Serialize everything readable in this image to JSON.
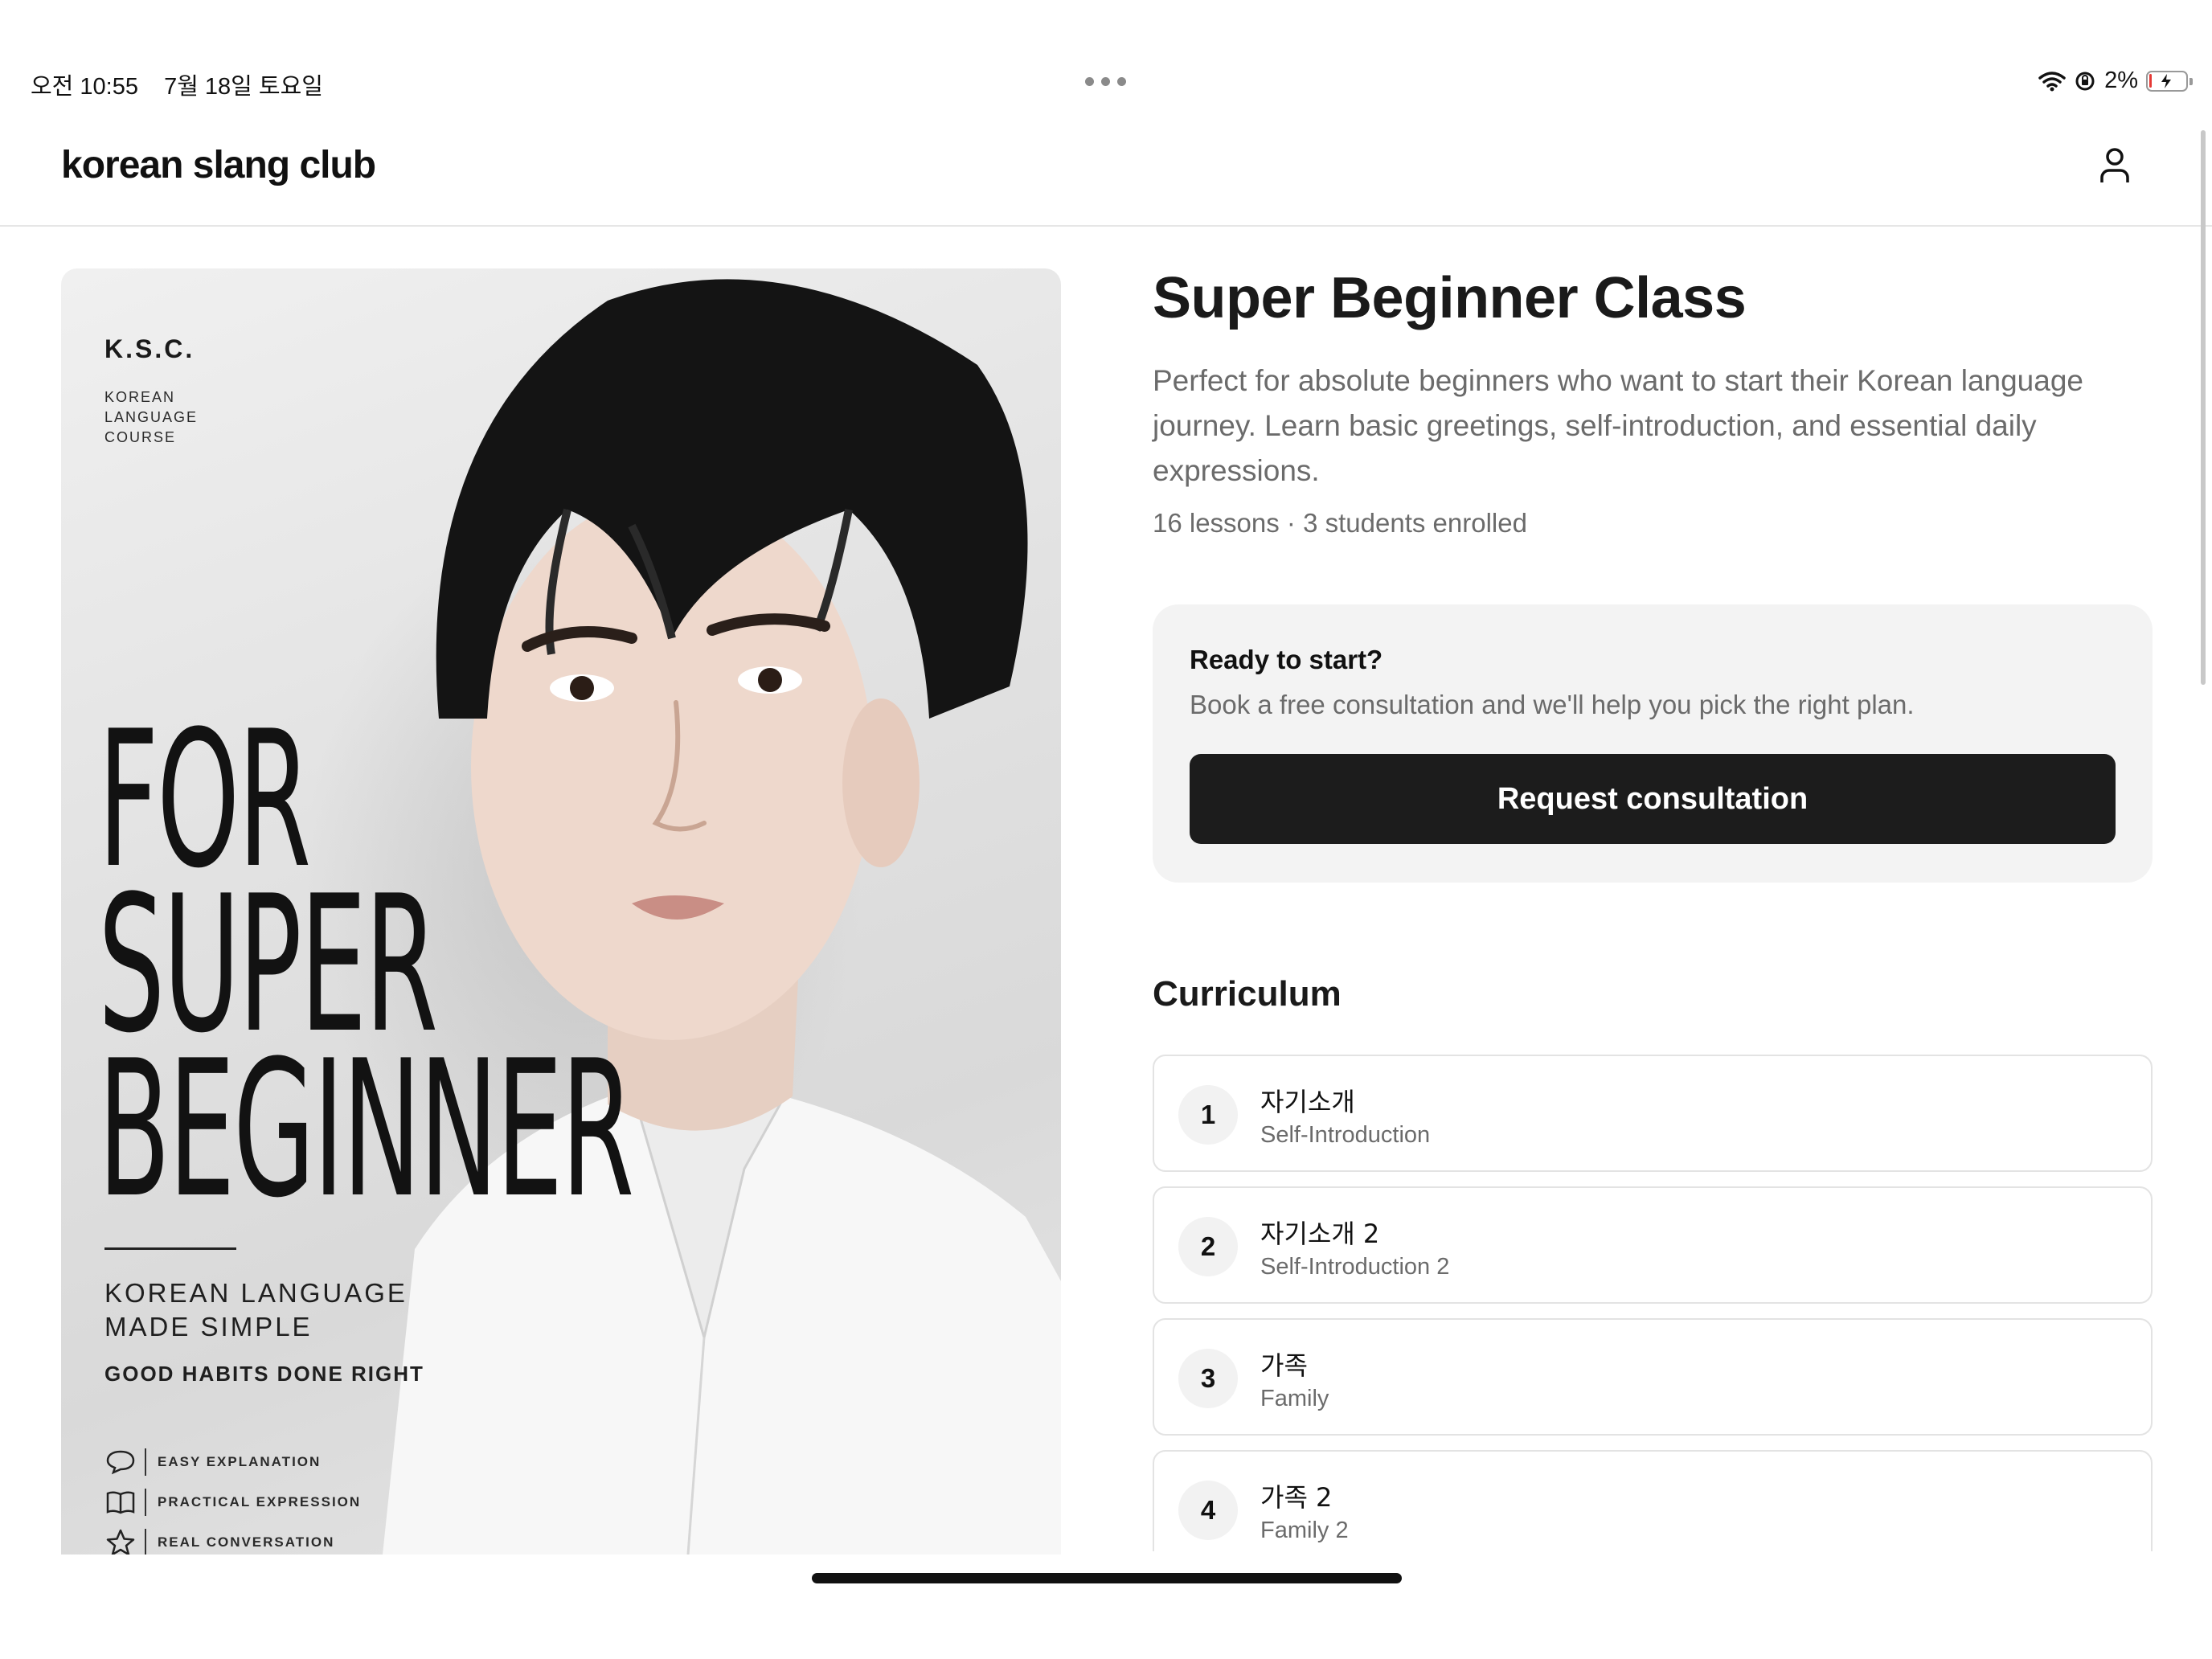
{
  "status_bar": {
    "time": "오전 10:55",
    "date": "7월 18일 토요일",
    "battery": "2%",
    "battery_level": 0.02
  },
  "header": {
    "brand": "korean slang club",
    "profile_icon": "person-icon"
  },
  "cover": {
    "badge": "K.S.C.",
    "badge_lines": [
      "KOREAN",
      "LANGUAGE",
      "COURSE"
    ],
    "title_lines": [
      "FOR",
      "SUPER",
      "BEGINNER"
    ],
    "tagline_lines": [
      "KOREAN LANGUAGE",
      "MADE SIMPLE"
    ],
    "habit": "GOOD HABITS DONE RIGHT",
    "features": [
      {
        "icon": "speech-bubble-icon",
        "label": "EASY EXPLANATION"
      },
      {
        "icon": "open-book-icon",
        "label": "PRACTICAL EXPRESSION"
      },
      {
        "icon": "star-icon",
        "label": "REAL CONVERSATION"
      }
    ]
  },
  "course": {
    "title": "Super Beginner Class",
    "description": "Perfect for absolute beginners who want to start their Korean language journey. Learn basic greetings, self-introduction, and essential daily expressions.",
    "meta": "16 lessons · 3 students enrolled"
  },
  "cta": {
    "heading": "Ready to start?",
    "subtext": "Book a free consultation and we'll help you pick the right plan.",
    "button_label": "Request consultation"
  },
  "curriculum": {
    "title": "Curriculum",
    "lessons": [
      {
        "number": "1",
        "korean": "자기소개",
        "english": "Self-Introduction"
      },
      {
        "number": "2",
        "korean": "자기소개 2",
        "english": "Self-Introduction 2"
      },
      {
        "number": "3",
        "korean": "가족",
        "english": "Family"
      },
      {
        "number": "4",
        "korean": "가족 2",
        "english": "Family 2"
      }
    ]
  },
  "colors": {
    "accent_button": "#1c1c1c",
    "card_background": "#f3f3f3",
    "muted_text": "#6b6b6b"
  }
}
